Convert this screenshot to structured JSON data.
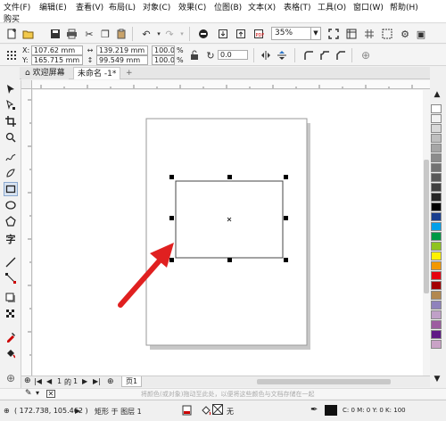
{
  "menubar": {
    "items": [
      "文件(F)",
      "编辑(E)",
      "查看(V)",
      "布局(L)",
      "对象(C)",
      "效果(C)",
      "位图(B)",
      "文本(X)",
      "表格(T)",
      "工具(O)",
      "窗口(W)",
      "帮助(H)"
    ],
    "second_row": [
      "购买"
    ]
  },
  "toolbar": {
    "zoom": "35%"
  },
  "properties": {
    "x": "107.62 mm",
    "y": "165.715 mm",
    "width": "139.219 mm",
    "height": "99.549 mm",
    "scale_x": "100.0",
    "scale_y": "100.0",
    "percent": "%",
    "rotation": "0.0",
    "x_label": "X:",
    "y_label": "Y:"
  },
  "tabs": [
    "欢迎屏幕",
    "未命名 -1*"
  ],
  "pagebar": {
    "page_position": "1",
    "of_label": "的",
    "page_total": "1",
    "page_tab": "页1"
  },
  "hintbar": {
    "text": "将颜色(或对象)拖动至此处，以便将这些颜色与文档存储在一起"
  },
  "status": {
    "coords": "( 172.738, 105.462 )",
    "layer_text": "矩形 于 图层 1",
    "fill_text": "无",
    "outline_text": "C: 0 M: 0 Y: 0 K: 100"
  },
  "palette": [
    "#ffffff",
    "#f2f2f2",
    "#d9d9d9",
    "#bfbfbf",
    "#a6a6a6",
    "#8c8c8c",
    "#737373",
    "#595959",
    "#404040",
    "#262626",
    "#000000",
    "#1a3f8f",
    "#00a0e9",
    "#009944",
    "#8fc31f",
    "#fff100",
    "#f39800",
    "#e60012",
    "#a40000",
    "#b28850",
    "#8f82bc",
    "#c0a0c8",
    "#9d5da0",
    "#601986",
    "#c9a2c6"
  ],
  "colors": {
    "arrow": "#e02020",
    "handle": "#000000"
  }
}
